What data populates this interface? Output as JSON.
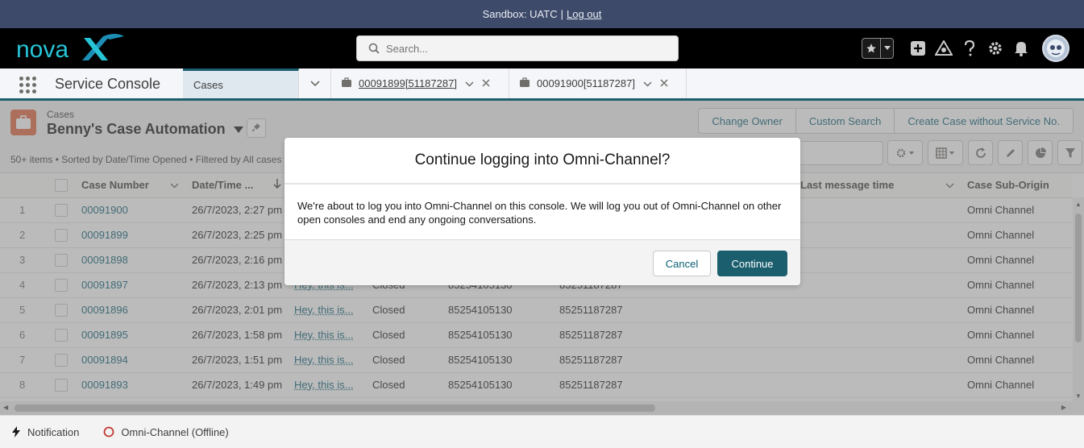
{
  "sandbox": {
    "text": "Sandbox: UATC",
    "separator": "|",
    "logout": "Log out"
  },
  "header": {
    "logo_text": "nova",
    "search_placeholder": "Search...",
    "icons": [
      "star-icon",
      "chevron-down-icon",
      "plus-icon",
      "trailhead-icon",
      "help-icon",
      "gear-icon",
      "bell-icon",
      "avatar"
    ]
  },
  "nav": {
    "app_name": "Service Console",
    "tabs": [
      {
        "label": "Cases"
      },
      {
        "label": "00091899[51187287]"
      },
      {
        "label": "00091900[51187287]"
      }
    ]
  },
  "list": {
    "object": "Cases",
    "view_name": "Benny's Case Automation",
    "meta": "50+ items • Sorted by Date/Time Opened • Filtered by All cases",
    "actions": [
      "Change Owner",
      "Custom Search",
      "Create Case without Service No."
    ],
    "columns": [
      "Case Number",
      "Date/Time ...",
      "Last message time",
      "Case Sub-Origin"
    ],
    "rows": [
      {
        "n": "1",
        "case": "00091900",
        "date": "26/7/2023, 2:27 pm",
        "msg": "",
        "status": "",
        "p1": "",
        "p2": "",
        "origin": "Omni Channel"
      },
      {
        "n": "2",
        "case": "00091899",
        "date": "26/7/2023, 2:25 pm",
        "msg": "",
        "status": "",
        "p1": "",
        "p2": "",
        "origin": "Omni Channel"
      },
      {
        "n": "3",
        "case": "00091898",
        "date": "26/7/2023, 2:16 pm",
        "msg": "",
        "status": "",
        "p1": "",
        "p2": "",
        "origin": "Omni Channel"
      },
      {
        "n": "4",
        "case": "00091897",
        "date": "26/7/2023, 2:13 pm",
        "msg": "Hey, this is...",
        "status": "Closed",
        "p1": "85254105130",
        "p2": "85251187287",
        "origin": "Omni Channel"
      },
      {
        "n": "5",
        "case": "00091896",
        "date": "26/7/2023, 2:01 pm",
        "msg": "Hey, this is...",
        "status": "Closed",
        "p1": "85254105130",
        "p2": "85251187287",
        "origin": "Omni Channel"
      },
      {
        "n": "6",
        "case": "00091895",
        "date": "26/7/2023, 1:58 pm",
        "msg": "Hey, this is...",
        "status": "Closed",
        "p1": "85254105130",
        "p2": "85251187287",
        "origin": "Omni Channel"
      },
      {
        "n": "7",
        "case": "00091894",
        "date": "26/7/2023, 1:51 pm",
        "msg": "Hey, this is...",
        "status": "Closed",
        "p1": "85254105130",
        "p2": "85251187287",
        "origin": "Omni Channel"
      },
      {
        "n": "8",
        "case": "00091893",
        "date": "26/7/2023, 1:49 pm",
        "msg": "Hey, this is...",
        "status": "Closed",
        "p1": "85254105130",
        "p2": "85251187287",
        "origin": "Omni Channel"
      }
    ]
  },
  "modal": {
    "title": "Continue logging into Omni-Channel?",
    "body": "We're about to log you into Omni-Channel on this console. We will log you out of Omni-Channel on other open consoles and end any ongoing conversations.",
    "cancel": "Cancel",
    "continue": "Continue"
  },
  "utility": {
    "notification": "Notification",
    "omni": "Omni-Channel (Offline)"
  },
  "colors": {
    "brand": "#1b5f6e",
    "sandbox_bar": "#3e4a6a",
    "link": "#0b5f74",
    "object_icon": "#e0673e",
    "offline": "#c23934"
  }
}
